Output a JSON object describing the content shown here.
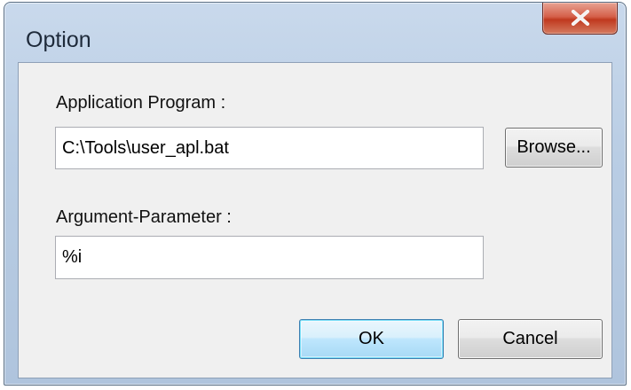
{
  "window": {
    "title": "Option"
  },
  "application": {
    "label": "Application Program :",
    "value": "C:\\Tools\\user_apl.bat",
    "browse_label": "Browse..."
  },
  "argument": {
    "label": "Argument-Parameter :",
    "value": "%i"
  },
  "buttons": {
    "ok_label": "OK",
    "cancel_label": "Cancel"
  },
  "colors": {
    "close_button": "#c0391f",
    "frame": "#b9cde4",
    "default_button_border": "#3c7fb1"
  },
  "icons": {
    "close": "close-icon"
  }
}
